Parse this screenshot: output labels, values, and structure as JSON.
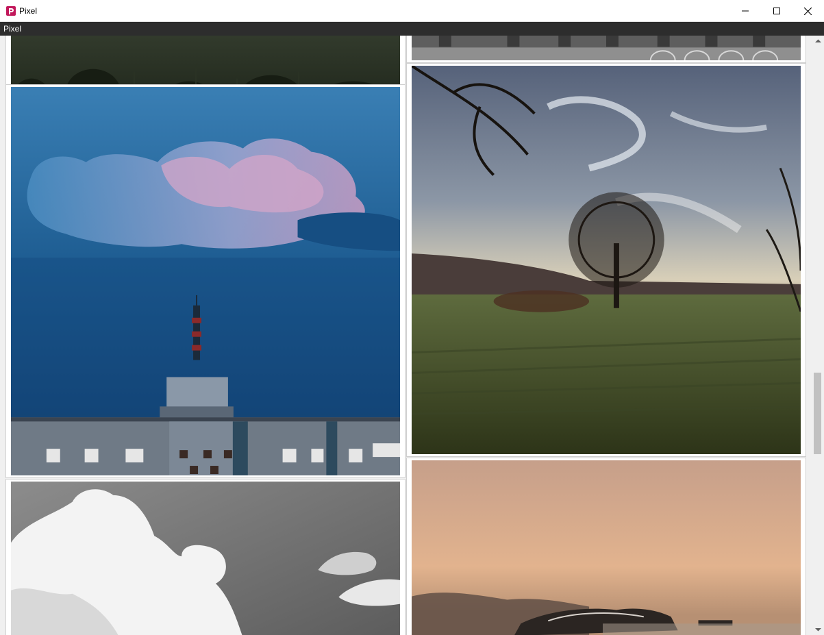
{
  "window": {
    "title": "Pixel",
    "logo_icon": "pixel-logo-icon",
    "controls": [
      "minimize-icon",
      "maximize-icon",
      "close-icon"
    ]
  },
  "menubar": {
    "label": "Pixel"
  },
  "gallery": {
    "photos": [
      {
        "subject": "forest-hillside"
      },
      {
        "subject": "building-facade"
      },
      {
        "subject": "storm-clouds-tower"
      },
      {
        "subject": "lone-tree-field"
      },
      {
        "subject": "white-clouds"
      },
      {
        "subject": "sunset-car-dust"
      }
    ]
  },
  "scrollbar": {
    "position_fraction": 0.56
  },
  "colors": {
    "menubar_bg": "#2d2d2d",
    "logo": "#c2185b"
  }
}
